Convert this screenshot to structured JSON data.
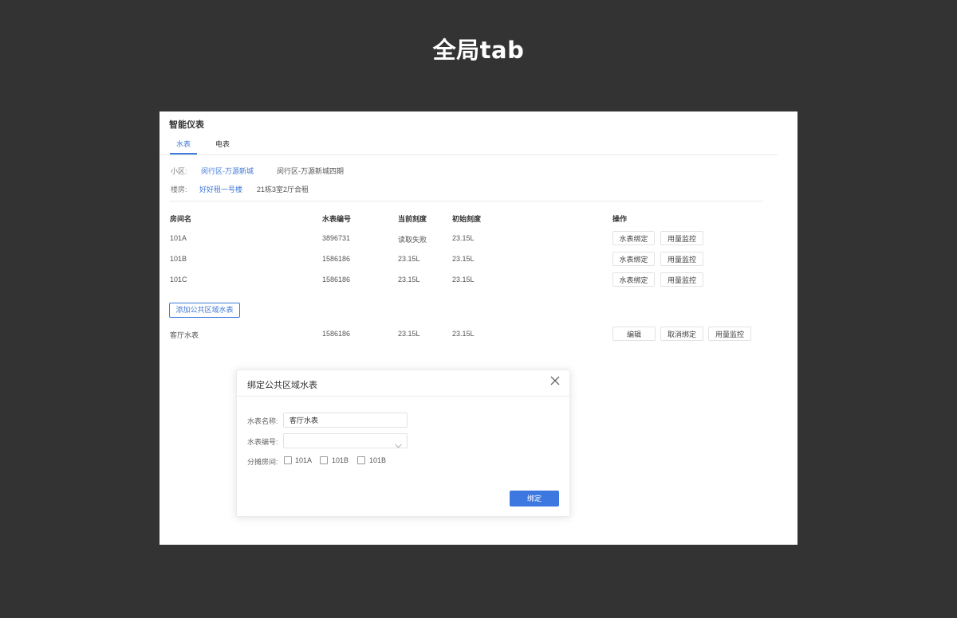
{
  "headline": "全局tab",
  "page_title": "智能仪表",
  "tabs": [
    {
      "label": "水表",
      "active": true
    },
    {
      "label": "电表",
      "active": false
    }
  ],
  "filters": {
    "community_label": "小区:",
    "community_link": "闵行区-万源新城",
    "community_other": "闵行区-万源新城四期",
    "building_label": "楼房:",
    "building_link": "好好租一号楼",
    "building_other": "21栋3室2厅合租"
  },
  "table": {
    "headers": [
      "房间名",
      "水表编号",
      "当前刻度",
      "初始刻度",
      "操作"
    ],
    "rows": [
      {
        "room": "101A",
        "meter_no": "3896731",
        "current": "读取失败",
        "initial": "23.15L",
        "actions": [
          "水表绑定",
          "用量监控"
        ]
      },
      {
        "room": "101B",
        "meter_no": "1586186",
        "current": "23.15L",
        "initial": "23.15L",
        "actions": [
          "水表绑定",
          "用量监控"
        ]
      },
      {
        "room": "101C",
        "meter_no": "1586186",
        "current": "23.15L",
        "initial": "23.15L",
        "actions": [
          "水表绑定",
          "用量监控"
        ]
      }
    ]
  },
  "add_public_button": "添加公共区域水表",
  "public_row": {
    "room": "客厅水表",
    "meter_no": "1586186",
    "current": "23.15L",
    "initial": "23.15L",
    "actions": [
      "编辑",
      "取消绑定",
      "用量监控"
    ]
  },
  "dialog": {
    "title": "绑定公共区域水表",
    "name_label": "水表名称:",
    "name_value": "客厅水表",
    "number_label": "水表编号:",
    "number_value": "",
    "rooms_label": "分摊房间:",
    "rooms": [
      "101A",
      "101B",
      "101B"
    ],
    "submit": "绑定"
  },
  "colors": {
    "accent": "#3f79d9",
    "background": "#333333",
    "submit": "#3d78e0"
  }
}
